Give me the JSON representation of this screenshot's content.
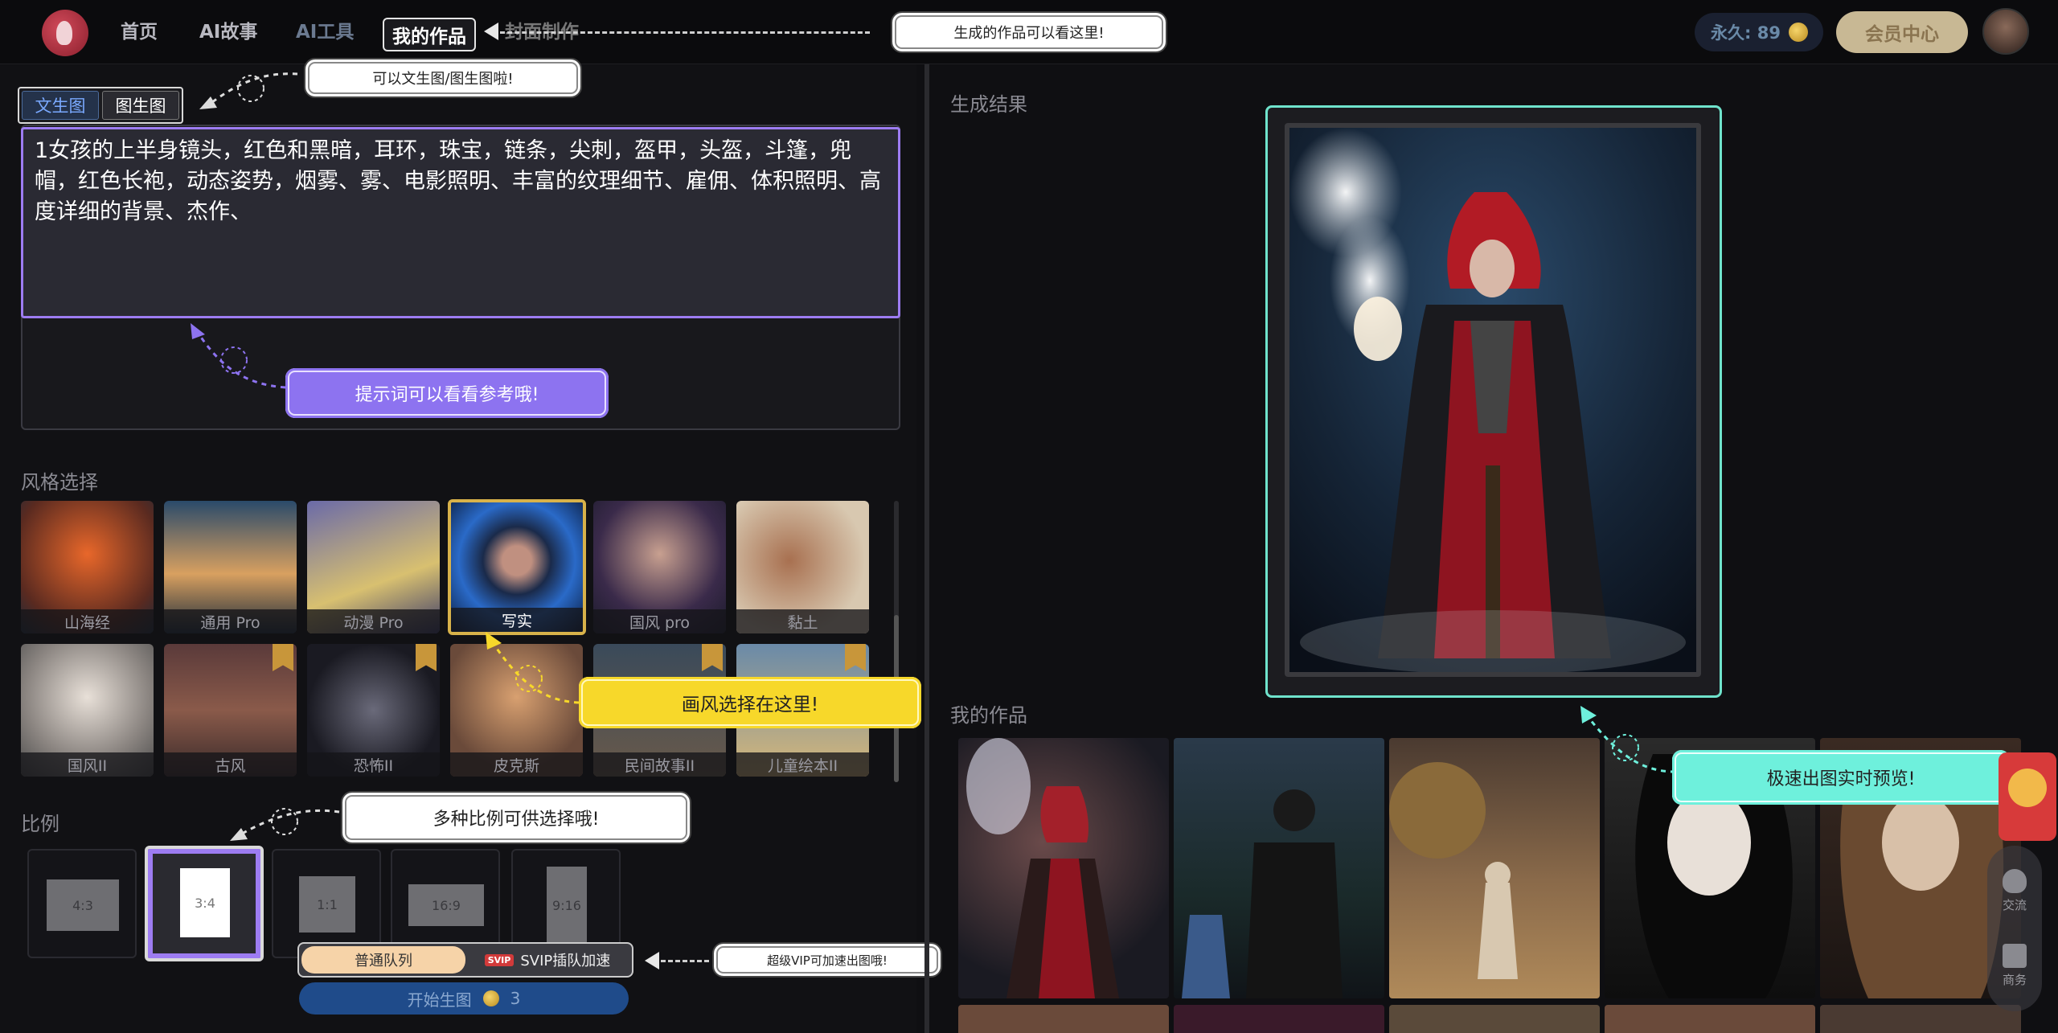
{
  "nav": {
    "items": [
      "首页",
      "AI故事",
      "AI工具",
      "我的作品",
      "封面制作"
    ],
    "active": "我的作品"
  },
  "tips": {
    "works": "生成的作品可以看这里!",
    "mode": "可以文生图/图生图啦!",
    "prompt_ref": "提示词可以看看参考哦!",
    "style": "画风选择在这里!",
    "ratio": "多种比例可供选择哦!",
    "svip": "超级VIP可加速出图哦!",
    "preview": "极速出图实时预览!"
  },
  "account": {
    "points_label": "永久: 89",
    "member_button": "会员中心"
  },
  "mode_tabs": [
    "文生图",
    "图生图"
  ],
  "prompt": {
    "text": "1女孩的上半身镜头，红色和黑暗，耳环，珠宝，链条，尖刺，盔甲，头盔，斗篷，兜帽，红色长袍，动态姿势，烟雾、雾、电影照明、丰富的纹理细节、雇佣、体积照明、高度详细的背景、杰作、"
  },
  "style_section": {
    "title": "风格选择",
    "styles": [
      {
        "label": "山海经",
        "vip": false
      },
      {
        "label": "通用 Pro",
        "vip": false
      },
      {
        "label": "动漫 Pro",
        "vip": false
      },
      {
        "label": "写实",
        "vip": false,
        "selected": true
      },
      {
        "label": "国风 pro",
        "vip": false
      },
      {
        "label": "黏土",
        "vip": false
      },
      {
        "label": "国风II",
        "vip": false
      },
      {
        "label": "古风",
        "vip": true
      },
      {
        "label": "恐怖II",
        "vip": true
      },
      {
        "label": "皮克斯",
        "vip": false
      },
      {
        "label": "民间故事II",
        "vip": true
      },
      {
        "label": "儿童绘本II",
        "vip": true
      }
    ]
  },
  "ratio_section": {
    "title": "比例",
    "ratios": [
      "4:3",
      "3:4",
      "1:1",
      "16:9",
      "9:16"
    ],
    "selected": "3:4"
  },
  "queue": {
    "normal": "普通队列",
    "svip_tag": "SVIP",
    "svip": "SVIP插队加速"
  },
  "start": {
    "label": "开始生图",
    "cost": "3"
  },
  "result": {
    "title": "生成结果"
  },
  "works": {
    "title": "我的作品"
  },
  "side_float": {
    "chat": "交流",
    "business": "商务"
  },
  "colors": {
    "accent_purple": "#9d7cf2",
    "accent_cyan": "#6fe3cc",
    "accent_yellow": "#f7d82a",
    "selected_gold": "#d8b24a",
    "start_blue": "#1f4b8a"
  }
}
